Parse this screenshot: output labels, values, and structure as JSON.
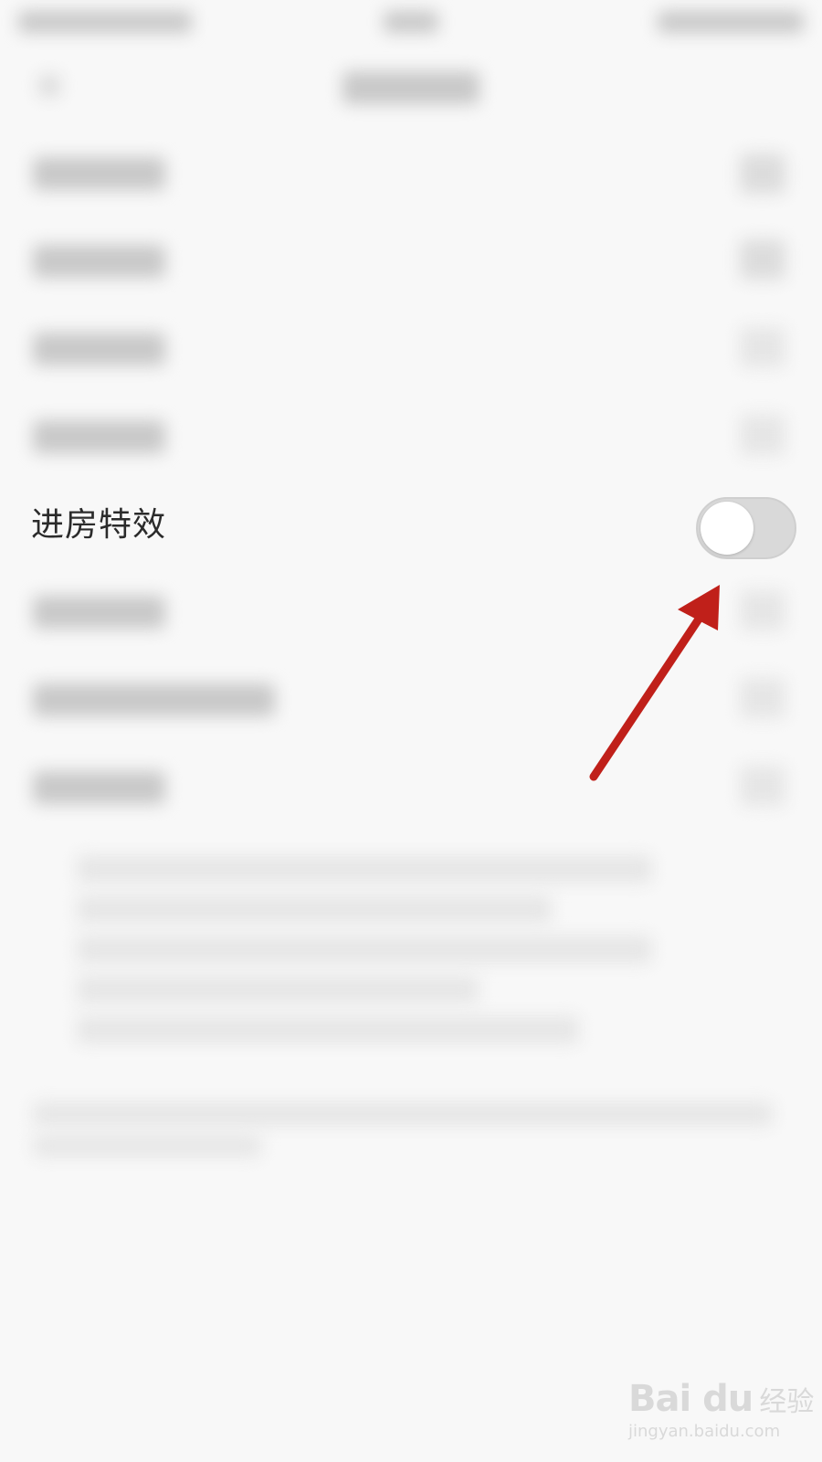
{
  "settings": {
    "room_effect_label": "进房特效",
    "room_effect_toggle": {
      "state": "off"
    }
  },
  "annotation": {
    "arrow_color": "#c0201a"
  },
  "watermark": {
    "logo": "Bai  du",
    "cn": "经验",
    "url": "jingyan.baidu.com"
  }
}
